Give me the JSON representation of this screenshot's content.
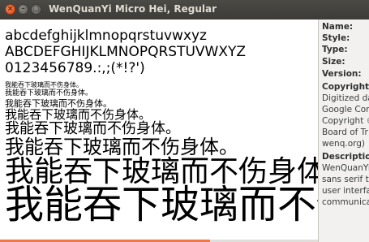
{
  "window": {
    "title": "WenQuanYi Micro Hei, Regular"
  },
  "preview": {
    "lines": [
      "abcdefghijklmnopqrstuvwxyz",
      "ABCDEFGHIJKLMNOPQRSTUVWXYZ",
      "0123456789.:,;(*!?')"
    ],
    "sample": "我能吞下玻璃而不伤身体。",
    "progress_fraction": 0.66
  },
  "info": {
    "name_label": "Name:",
    "style_label": "Style:",
    "type_label": "Type:",
    "size_label": "Size:",
    "version_label": "Version:",
    "copyright_label": "Copyright:",
    "copyright_lines": [
      "Digitized da",
      "Google Cor",
      "Copyright ©",
      "Board of Tr",
      "wenq.org)"
    ],
    "description_label": "Description",
    "description_lines": [
      "WenQuanYi",
      "sans serif ty",
      "user interfa",
      "communica"
    ]
  },
  "colors": {
    "titlebar": "#3c3b37",
    "close_button": "#dd4814",
    "progress": "#f07746"
  }
}
